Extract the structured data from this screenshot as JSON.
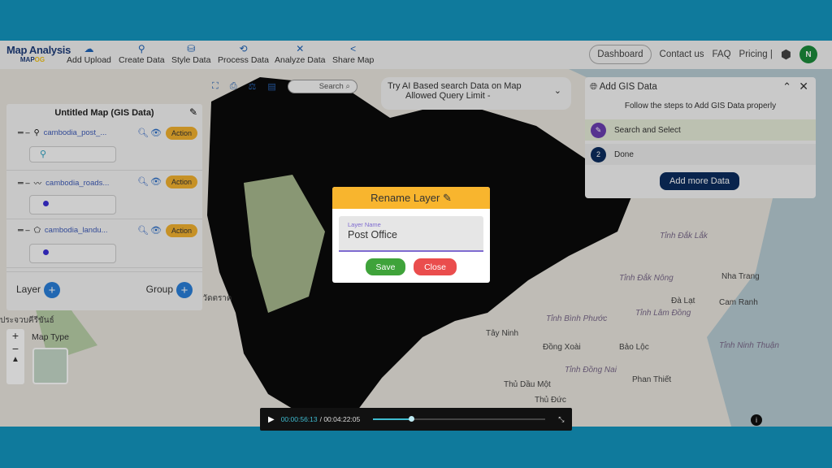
{
  "header": {
    "logo_title": "Map Analysis",
    "logo_sub_a": "MAP",
    "logo_sub_b": "OG",
    "nav": [
      {
        "label": "Add Upload",
        "icon": "cloud-upload-icon"
      },
      {
        "label": "Create Data",
        "icon": "map-pin-icon"
      },
      {
        "label": "Style Data",
        "icon": "paint-bucket-icon"
      },
      {
        "label": "Process Data",
        "icon": "process-icon"
      },
      {
        "label": "Analyze Data",
        "icon": "analyze-icon"
      },
      {
        "label": "Share Map",
        "icon": "share-icon"
      }
    ],
    "dashboard": "Dashboard",
    "contact": "Contact us",
    "faq": "FAQ",
    "pricing": "Pricing |",
    "avatar": "N"
  },
  "panel": {
    "title": "Untitled Map (GIS Data)",
    "layers": [
      {
        "name": "cambodia_post_...",
        "type": "point"
      },
      {
        "name": "cambodia_roads...",
        "type": "line"
      },
      {
        "name": "cambodia_landu...",
        "type": "polygon"
      }
    ],
    "action": "Action",
    "layer_label": "Layer",
    "group_label": "Group"
  },
  "toolbar": {
    "search": "Search"
  },
  "ai": {
    "line1": "Try AI Based search Data on Map",
    "line2": "Allowed Query Limit -"
  },
  "gis": {
    "title": "Add GIS Data",
    "subtitle": "Follow the steps to Add GIS Data properly",
    "steps": [
      {
        "num": "",
        "label": "Search and Select"
      },
      {
        "num": "2",
        "label": "Done"
      }
    ],
    "add_more": "Add more Data"
  },
  "dialog": {
    "title": "Rename Layer",
    "field_label": "Layer Name",
    "field_value": "Post Office",
    "save": "Save",
    "close": "Close"
  },
  "map": {
    "map_type": "Map Type",
    "labels": [
      "Tỉnh Đắk Lắk",
      "Nha Trang",
      "Đà Lạt",
      "Cam Ranh",
      "Tỉnh Lâm Đồng",
      "Bảo Lộc",
      "Đồng Xoài",
      "Phan Thiết",
      "Tây Ninh",
      "Thủ Dầu Một",
      "Thủ Đức",
      "Tỉnh Ninh Thuận",
      "Tỉnh Đắk Nông",
      "Tỉnh Bình Phước",
      "Tỉnh Đồng Nai",
      "ประจวบคีรีขันธ์",
      "จังหวัดตราด"
    ]
  },
  "video": {
    "current": "00:00:56:13",
    "total": "/ 00:04:22:05",
    "progress": 0.22
  },
  "colors": {
    "accent": "#2a7fd9",
    "action": "#f2b12f",
    "frame": "#0f7a9c",
    "save": "#3fa33a",
    "close": "#ea4d4d"
  }
}
